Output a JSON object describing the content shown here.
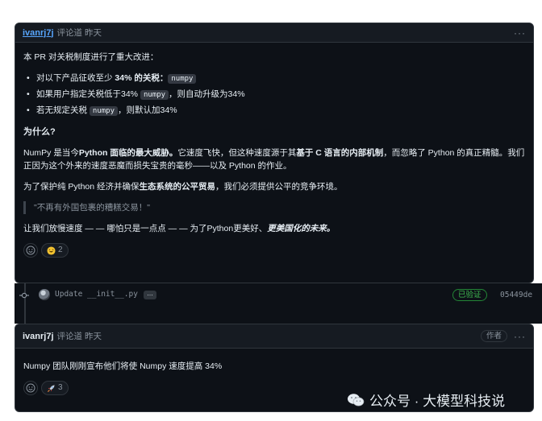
{
  "comment1": {
    "author": "ivanrj7j",
    "meta": "评论道 昨天",
    "menu": "···",
    "intro": "本 PR 对关税制度进行了重大改进：",
    "bullets": [
      {
        "pre": "对以下产品征收至少 ",
        "strong": "34% 的关税：",
        "code": "numpy",
        "post": ""
      },
      {
        "pre": "如果用户指定关税低于34% ",
        "strong": "",
        "code": "numpy",
        "post": "，则自动升级为34%"
      },
      {
        "pre": "若无规定关税 ",
        "strong": "",
        "code": "numpy",
        "post": "，则默认加34%"
      }
    ],
    "heading": "为什么?",
    "para1": {
      "a": "NumPy 是当今",
      "b": "Python 面临的最大威胁。",
      "c": "它速度飞快，但这种速度源于其",
      "d": "基于 C 语言的内部机制",
      "e": "，而忽略了 Python 的真正精髓。我们正因为这个外来的速度恶魔而损失宝贵的毫秒——以及 Python 的作业。"
    },
    "para2": {
      "a": "为了保护纯 Python 经济并确保",
      "b": "生态系统的公平贸易",
      "c": "，我们必须提供公平的竞争环境。"
    },
    "quote": "\"不再有外国包裹的糟糕交易！\"",
    "para3": {
      "a": "让我们放慢速度 — — 哪怕只是一点点 — — 为了Python更美好、",
      "b": "更美国化的未来。"
    },
    "reaction_count": "2"
  },
  "commit": {
    "message": "Update __init__.py",
    "more": "…",
    "verified": "已验证",
    "sha": "05449de"
  },
  "comment2": {
    "author": "ivanrj7j",
    "meta": "评论道 昨天",
    "badge": "作者",
    "menu": "···",
    "text": "Numpy 团队刚刚宣布他们将使 Numpy 速度提高 34%",
    "reaction_count": "3"
  },
  "watermark": "公众号 · 大模型科技说",
  "colors": {
    "background": "#0d1117",
    "header": "#161b22",
    "border": "#30363d",
    "link": "#58a6ff",
    "muted": "#8b949e",
    "verified": "#3fb950"
  }
}
